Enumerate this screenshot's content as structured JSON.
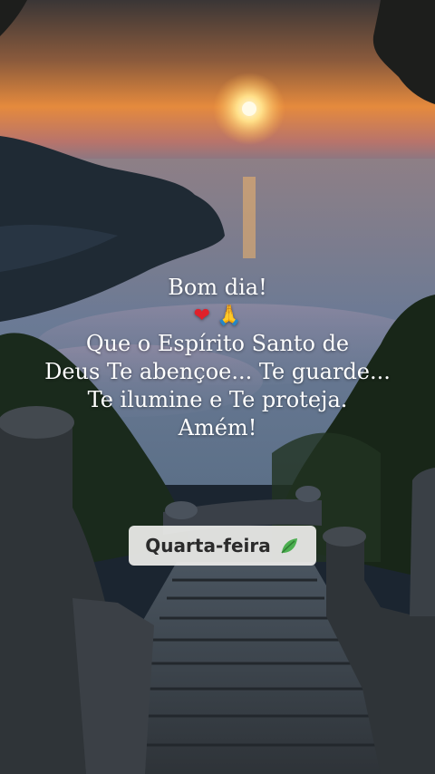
{
  "message": {
    "greeting": "Bom dia!",
    "emojis": [
      "heart-emoji",
      "praying-hands-emoji"
    ],
    "lines": [
      "Que o Espírito Santo de",
      "Deus Te abençoe... Te guarde...",
      "Te ilumine e Te proteja.",
      "Amém!"
    ]
  },
  "badge": {
    "day": "Quarta-feira",
    "icon": "leaf-icon"
  },
  "colors": {
    "sky_top": "#3a3a3c",
    "sky_glow": "#e8813a",
    "sea": "#4a6a86",
    "heart": "#e0202a",
    "leaf": "#4caf50"
  }
}
